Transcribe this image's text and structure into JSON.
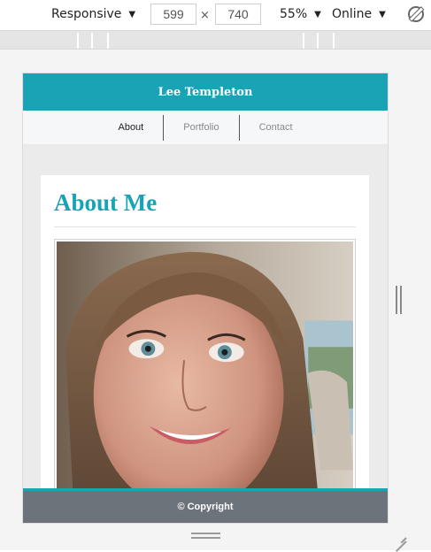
{
  "toolbar": {
    "device": "Responsive",
    "width": "599",
    "height": "740",
    "times": "×",
    "zoom": "55%",
    "network": "Online",
    "caret": "▼"
  },
  "site": {
    "title": "Lee Templeton",
    "nav": [
      {
        "label": "About",
        "active": true
      },
      {
        "label": "Portfolio",
        "active": false
      },
      {
        "label": "Contact",
        "active": false
      }
    ],
    "heading": "About Me",
    "footer": "© Copyright"
  },
  "colors": {
    "accent": "#1aa2b5",
    "footer": "#6c737b",
    "nav_bg": "#f6f7f9"
  }
}
